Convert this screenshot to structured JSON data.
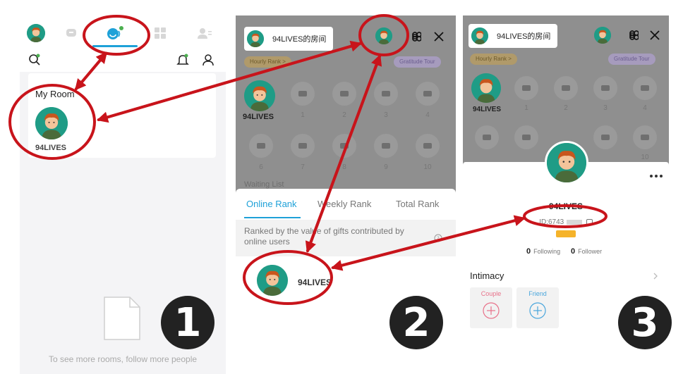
{
  "screen1": {
    "my_room_title": "My Room",
    "room_owner_name": "94LIVES",
    "empty_state_text": "To see more rooms, follow more people",
    "step_number": "1"
  },
  "screen2": {
    "room_chip_title": "94LIVES的房间",
    "hourly_rank_pill": "Hourly Rank >",
    "gratitude_pill": "Gratitude Tour",
    "host_name": "94LIVES",
    "seat_numbers": [
      "1",
      "2",
      "3",
      "4",
      "5",
      "6",
      "7",
      "8",
      "9",
      "10"
    ],
    "waiting_list_label": "Waiting List",
    "tabs": [
      "Online Rank",
      "Weekly Rank",
      "Total Rank"
    ],
    "rank_description": "Ranked by the value of gifts contributed by online users",
    "rank_user_name": "94LIVES",
    "step_number": "2"
  },
  "screen3": {
    "room_chip_title": "94LIVES的房间",
    "hourly_rank_pill": "Hourly Rank >",
    "gratitude_pill": "Gratitude Tour",
    "host_name": "94LIVES",
    "seat_numbers": [
      "1",
      "2",
      "3",
      "4",
      "5",
      "6",
      "7",
      "8",
      "9",
      "10"
    ],
    "profile_name": "94LIVES",
    "profile_id": "ID:6743",
    "following_count": "0",
    "following_label": "Following",
    "follower_count": "0",
    "follower_label": "Follower",
    "intimacy_label": "Intimacy",
    "couple_label": "Couple",
    "friend_label": "Friend",
    "step_number": "3"
  },
  "colors": {
    "accent_blue": "#1ea1d8",
    "annotation_red": "#c8141b",
    "avatar_teal": "#1f9c86",
    "overlay_gray": "#8f8f8f"
  }
}
